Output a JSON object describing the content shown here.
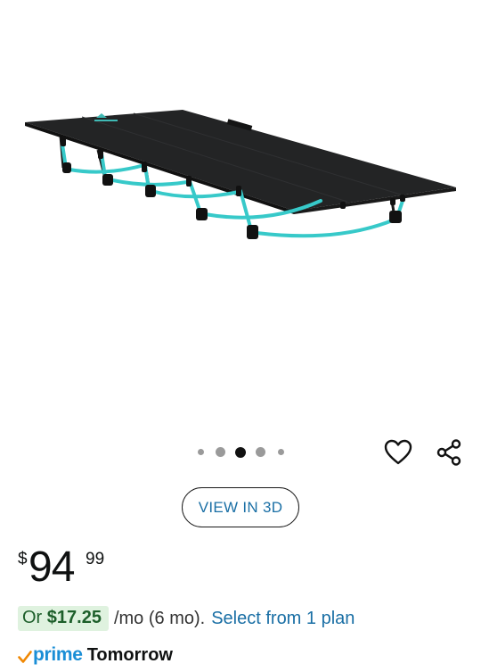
{
  "image": {
    "alt": "Black camping cot with teal curved legs",
    "colors": {
      "fabric": "#232425",
      "legs": "#37c9c9",
      "joints": "#1a1a1a"
    }
  },
  "carousel": {
    "count": 5,
    "active_index": 2
  },
  "actions": {
    "favorite_icon": "heart-icon",
    "share_icon": "share-icon"
  },
  "view_3d": {
    "label": "VIEW IN 3D"
  },
  "price": {
    "currency": "$",
    "whole": "94",
    "fraction": "99"
  },
  "installment": {
    "prefix": "Or ",
    "amount": "$17.25",
    "term": "/mo (6 mo).",
    "link": "Select from 1 plan"
  },
  "delivery": {
    "prime_label": "prime",
    "day": "Tomorrow",
    "prime_color": "#1a8ed6",
    "check_color": "#f08804"
  },
  "colors": {
    "link": "#1a6fa5",
    "badge_bg": "#dff2df",
    "badge_text": "#1d5f2a"
  }
}
